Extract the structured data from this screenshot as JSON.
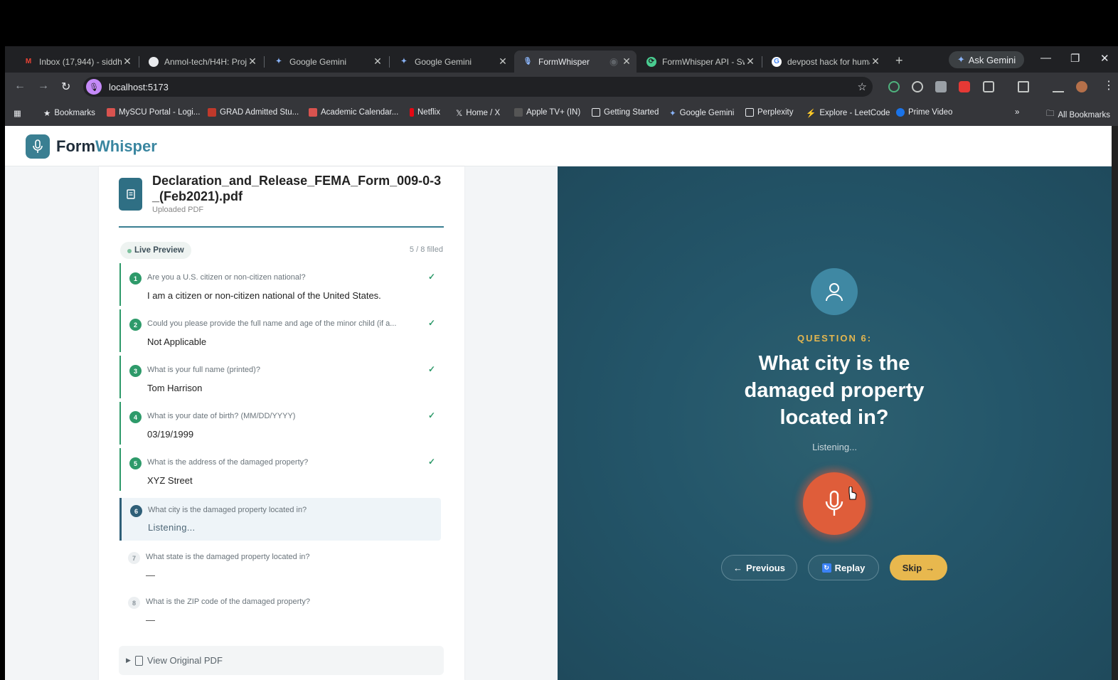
{
  "browser": {
    "tabs": [
      {
        "title": "Inbox (17,944) - siddha",
        "icon": "gmail-icon"
      },
      {
        "title": "Anmol-tech/H4H: Proj",
        "icon": "github-icon"
      },
      {
        "title": "Google Gemini",
        "icon": "gemini-icon"
      },
      {
        "title": "Google Gemini",
        "icon": "gemini-icon"
      },
      {
        "title": "FormWhisper",
        "icon": "mic-icon"
      },
      {
        "title": "FormWhisper API - Sw",
        "icon": "swagger-icon"
      },
      {
        "title": "devpost hack for huma",
        "icon": "google-icon"
      }
    ],
    "ask_gemini": "Ask Gemini",
    "url": "localhost:5173",
    "bookmarks": [
      "Bookmarks",
      "MySCU Portal - Logi...",
      "GRAD Admitted Stu...",
      "Academic Calendar...",
      "Netflix",
      "Home / X",
      "Apple TV+ (IN)",
      "Getting Started",
      "Google Gemini",
      "Perplexity",
      "Explore - LeetCode",
      "Prime Video"
    ],
    "all_bookmarks": "All Bookmarks"
  },
  "app": {
    "brand_a": "Form",
    "brand_b": "Whisper",
    "document": {
      "title": "Declaration_and_Release_FEMA_Form_009-0-3_(Feb2021).pdf",
      "subtitle": "Uploaded PDF"
    },
    "live_preview": "Live Preview",
    "filled": "5 / 8 filled",
    "questions": [
      {
        "n": "1",
        "q": "Are you a U.S. citizen or non-citizen national?",
        "a": "I am a citizen or non-citizen national of the United States."
      },
      {
        "n": "2",
        "q": "Could you please provide the full name and age of the minor child (if a...",
        "a": "Not Applicable"
      },
      {
        "n": "3",
        "q": "What is your full name (printed)?",
        "a": "Tom Harrison"
      },
      {
        "n": "4",
        "q": "What is your date of birth? (MM/DD/YYYY)",
        "a": "03/19/1999"
      },
      {
        "n": "5",
        "q": "What is the address of the damaged property?",
        "a": "XYZ Street"
      },
      {
        "n": "6",
        "q": "What city is the damaged property located in?",
        "a": "Listening..."
      },
      {
        "n": "7",
        "q": "What state is the damaged property located in?",
        "a": "—"
      },
      {
        "n": "8",
        "q": "What is the ZIP code of the damaged property?",
        "a": "—"
      }
    ],
    "view_pdf": "View Original PDF",
    "voice": {
      "question_label": "QUESTION 6:",
      "question_text": "What city is the damaged property located in?",
      "status": "Listening...",
      "previous": "Previous",
      "replay": "Replay",
      "skip": "Skip"
    }
  },
  "colors": {
    "accent": "#3a7f92",
    "done": "#2e9a6a",
    "mic": "#df5d3a",
    "skip": "#e8b84e",
    "panel": "#24566a"
  }
}
